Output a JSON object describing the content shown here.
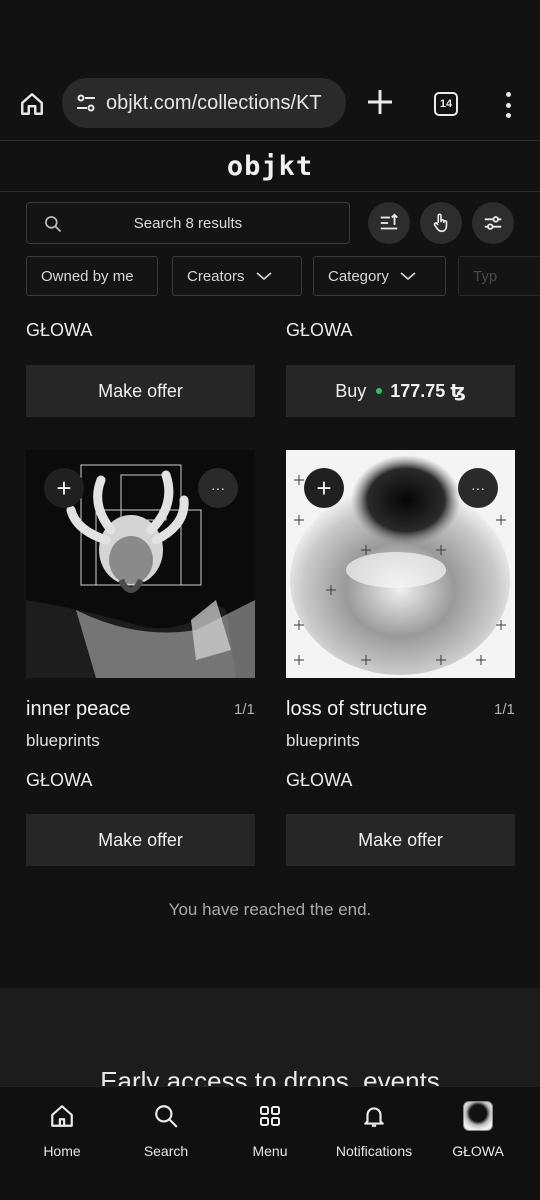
{
  "browser": {
    "url": "objkt.com/collections/KT",
    "tab_count": "14"
  },
  "site": {
    "logo": "objkt"
  },
  "toolbar": {
    "search_placeholder": "Search 8 results"
  },
  "filters": [
    {
      "label": "Owned by me"
    },
    {
      "label": "Creators"
    },
    {
      "label": "Category"
    },
    {
      "label": "Typ"
    }
  ],
  "top_row": {
    "left": {
      "artist": "GŁOWA",
      "action": "Make offer"
    },
    "right": {
      "artist": "GŁOWA",
      "action": "Buy",
      "price": "177.75 ꜩ"
    }
  },
  "cards": [
    {
      "title": "inner peace",
      "edition": "1/1",
      "collection": "blueprints",
      "artist": "GŁOWA",
      "action": "Make offer"
    },
    {
      "title": "loss of structure",
      "edition": "1/1",
      "collection": "blueprints",
      "artist": "GŁOWA",
      "action": "Make offer"
    }
  ],
  "card_overlay": {
    "add": "+",
    "more": "···"
  },
  "end_message": "You have reached the end.",
  "footer": {
    "headline": "Early access to drops, events"
  },
  "bottom_nav": [
    {
      "label": "Home",
      "icon": "home-icon"
    },
    {
      "label": "Search",
      "icon": "search-icon"
    },
    {
      "label": "Menu",
      "icon": "grid-icon"
    },
    {
      "label": "Notifications",
      "icon": "bell-icon"
    },
    {
      "label": "GŁOWA",
      "icon": "avatar"
    }
  ],
  "colors": {
    "background": "#121212",
    "buy_dot": "#29c16b",
    "button": "#262626"
  }
}
